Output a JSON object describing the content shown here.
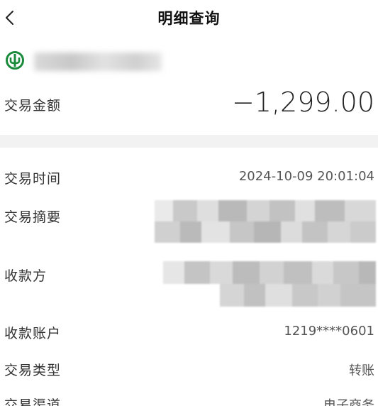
{
  "header": {
    "title": "明细查询",
    "back_icon": "chevron-left-icon"
  },
  "bank": {
    "logo_icon": "abc-bank-logo-icon",
    "logo_color": "#1a8a3c"
  },
  "amount": {
    "label": "交易金额",
    "value": "−1,299.00"
  },
  "details": {
    "time_label": "交易时间",
    "time_value": "2024-10-09 20:01:04",
    "summary_label": "交易摘要",
    "payee_label": "收款方",
    "account_label": "收款账户",
    "account_value": "1219****0601",
    "type_label": "交易类型",
    "type_value": "转账",
    "channel_label": "交易渠道",
    "channel_value": "电子商务"
  }
}
